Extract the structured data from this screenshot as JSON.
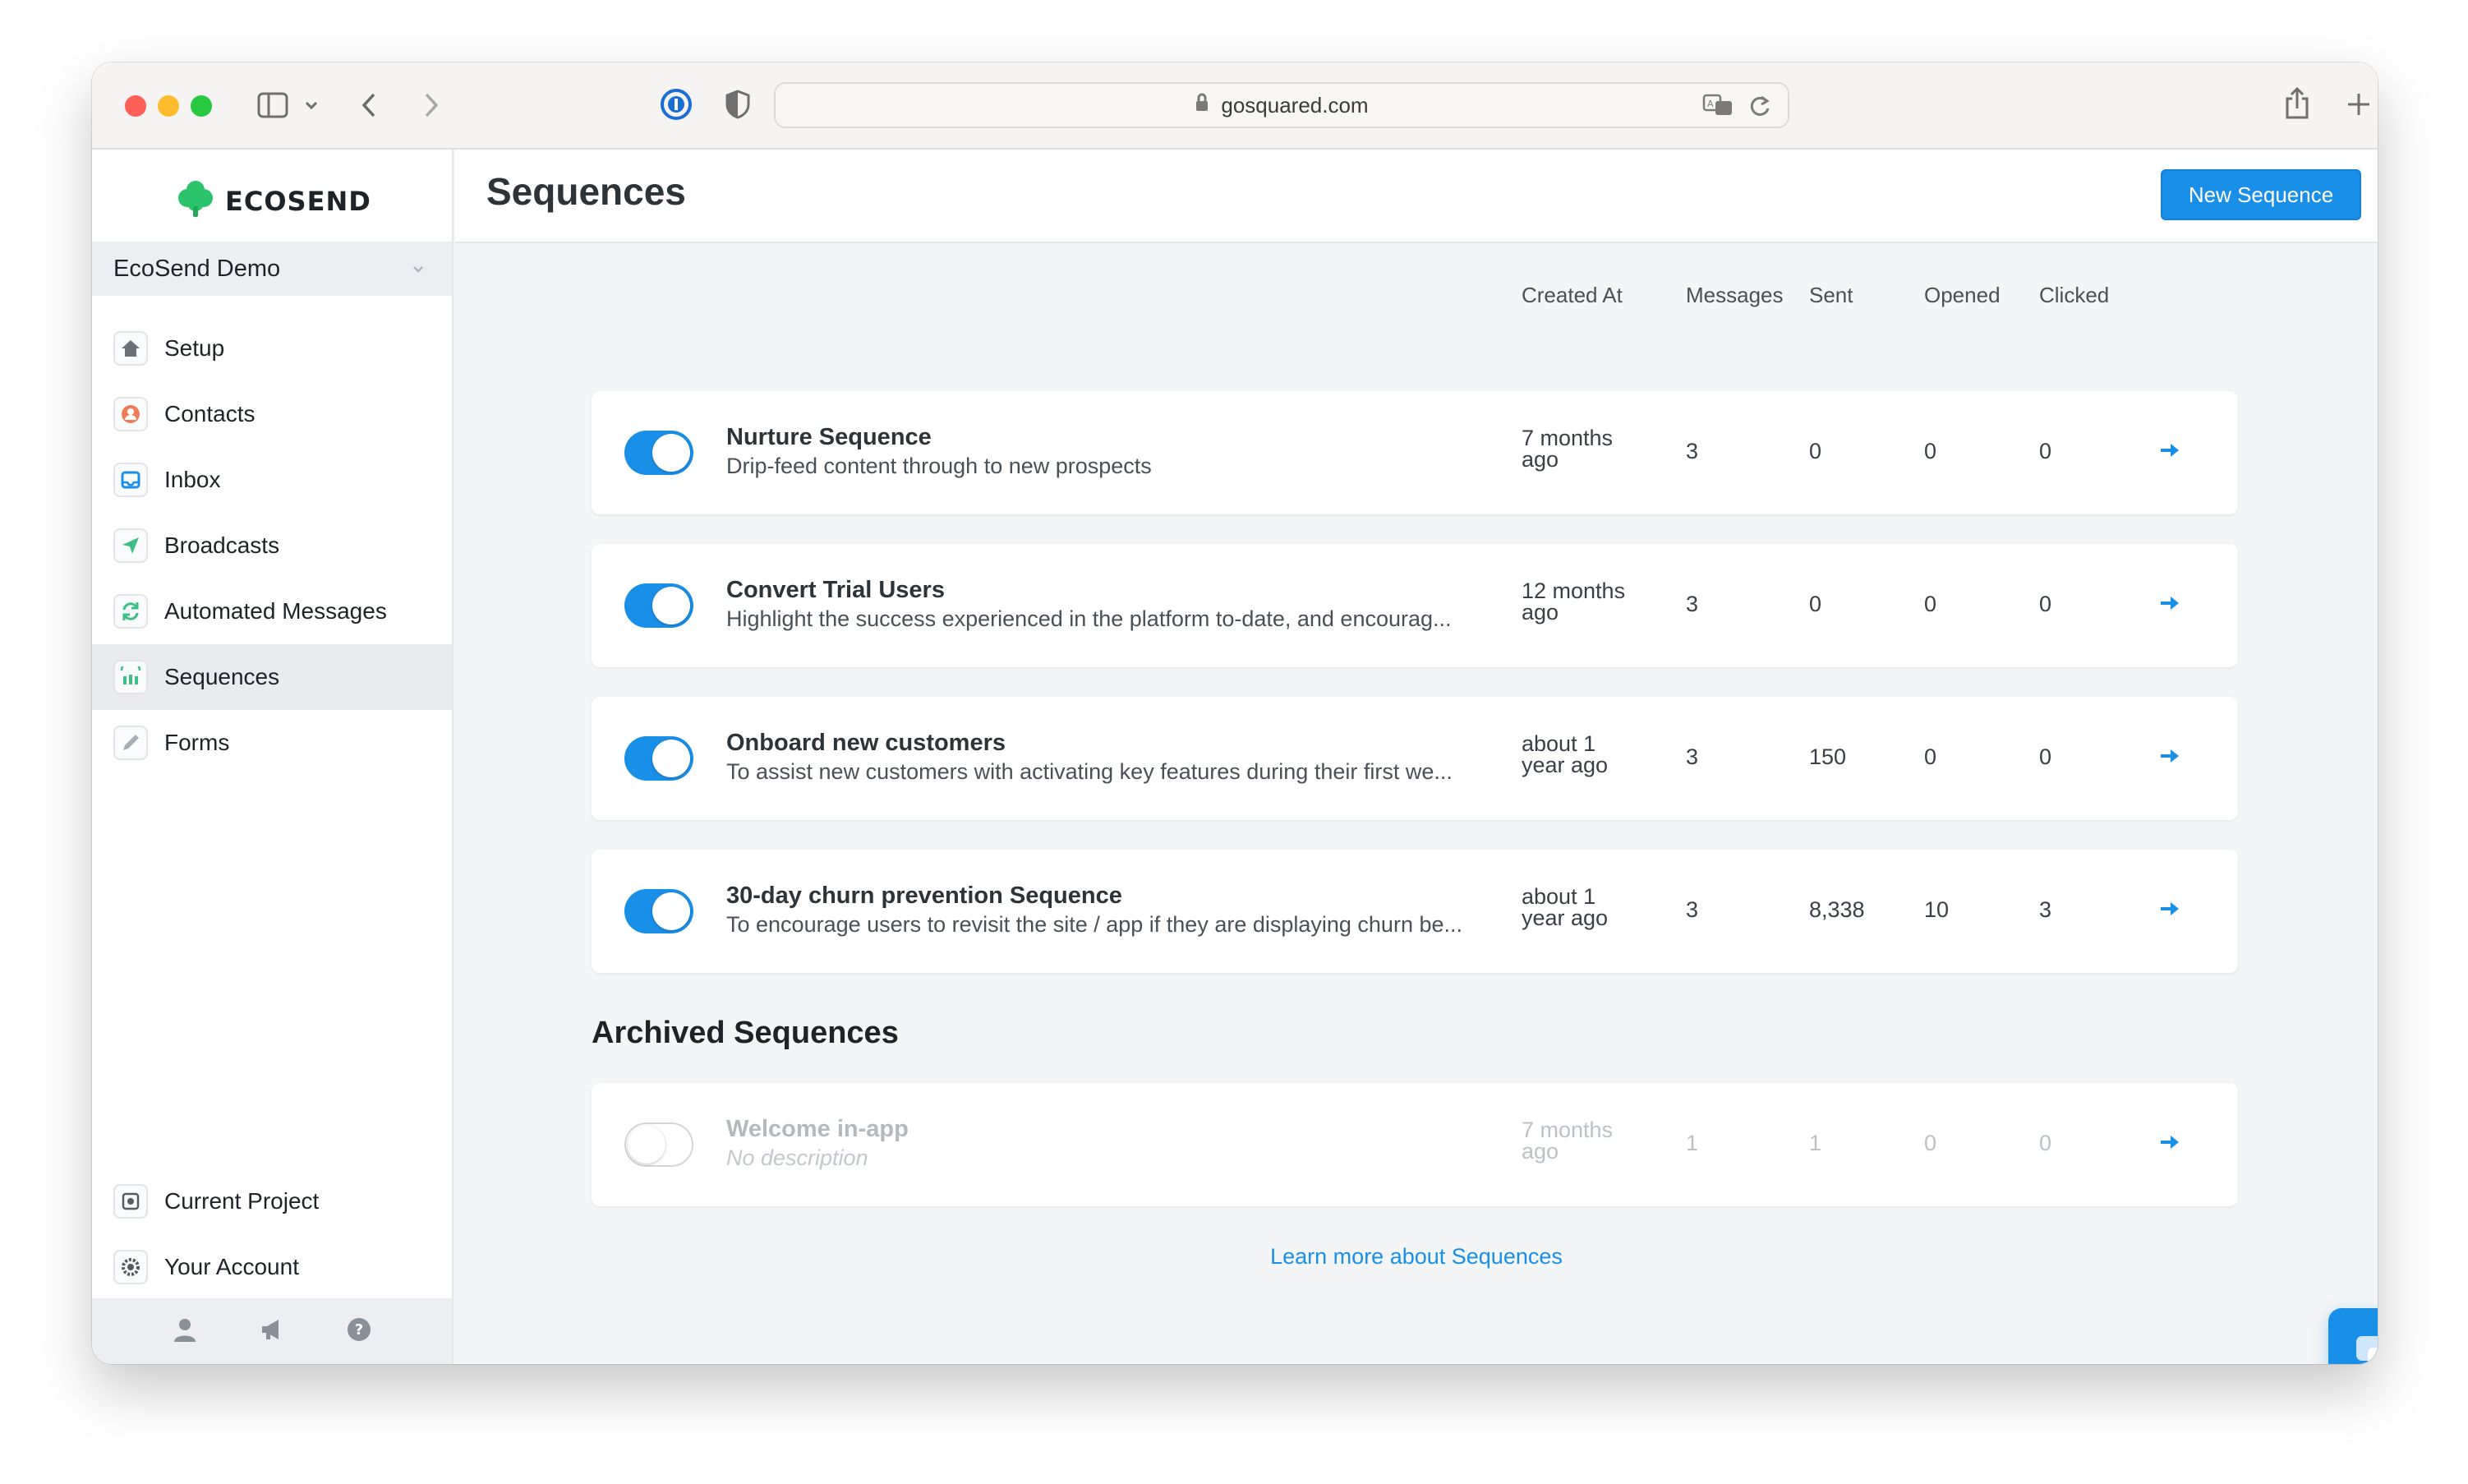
{
  "browser": {
    "url": "gosquared.com"
  },
  "sidebar": {
    "brand": "ECOSEND",
    "project": "EcoSend Demo",
    "nav": [
      {
        "label": "Setup",
        "icon": "home-icon"
      },
      {
        "label": "Contacts",
        "icon": "contacts-icon"
      },
      {
        "label": "Inbox",
        "icon": "inbox-icon"
      },
      {
        "label": "Broadcasts",
        "icon": "send-icon"
      },
      {
        "label": "Automated Messages",
        "icon": "refresh-icon"
      },
      {
        "label": "Sequences",
        "icon": "sequences-icon",
        "active": true
      },
      {
        "label": "Forms",
        "icon": "pencil-icon"
      }
    ],
    "bottom_nav": [
      {
        "label": "Current Project",
        "icon": "project-icon"
      },
      {
        "label": "Your Account",
        "icon": "gear-icon"
      }
    ],
    "footer_icons": [
      "user-icon",
      "megaphone-icon",
      "help-icon"
    ]
  },
  "header": {
    "title": "Sequences",
    "new_button": "New Sequence"
  },
  "columns": {
    "created": "Created At",
    "messages": "Messages",
    "sent": "Sent",
    "opened": "Opened",
    "clicked": "Clicked"
  },
  "sequences": [
    {
      "name": "Nurture Sequence",
      "description": "Drip-feed content through to new prospects",
      "created": "7 months ago",
      "messages": "3",
      "sent": "0",
      "opened": "0",
      "clicked": "0",
      "enabled": true
    },
    {
      "name": "Convert Trial Users",
      "description": "Highlight the success experienced in the platform to-date, and encourag...",
      "created": "12 months ago",
      "messages": "3",
      "sent": "0",
      "opened": "0",
      "clicked": "0",
      "enabled": true
    },
    {
      "name": "Onboard new customers",
      "description": "To assist new customers with activating key features during their first we...",
      "created": "about 1 year ago",
      "messages": "3",
      "sent": "150",
      "opened": "0",
      "clicked": "0",
      "enabled": true
    },
    {
      "name": "30-day churn prevention Sequence",
      "description": "To encourage users to revisit the site / app if they are displaying churn be...",
      "created": "about 1 year ago",
      "messages": "3",
      "sent": "8,338",
      "opened": "10",
      "clicked": "3",
      "enabled": true
    }
  ],
  "archived": {
    "title": "Archived Sequences",
    "items": [
      {
        "name": "Welcome in-app",
        "description": "No description",
        "created": "7 months ago",
        "messages": "1",
        "sent": "1",
        "opened": "0",
        "clicked": "0",
        "enabled": false
      }
    ]
  },
  "footer_link": "Learn more about Sequences",
  "colors": {
    "accent": "#1a8fe8",
    "brand_green": "#2cc46b"
  }
}
